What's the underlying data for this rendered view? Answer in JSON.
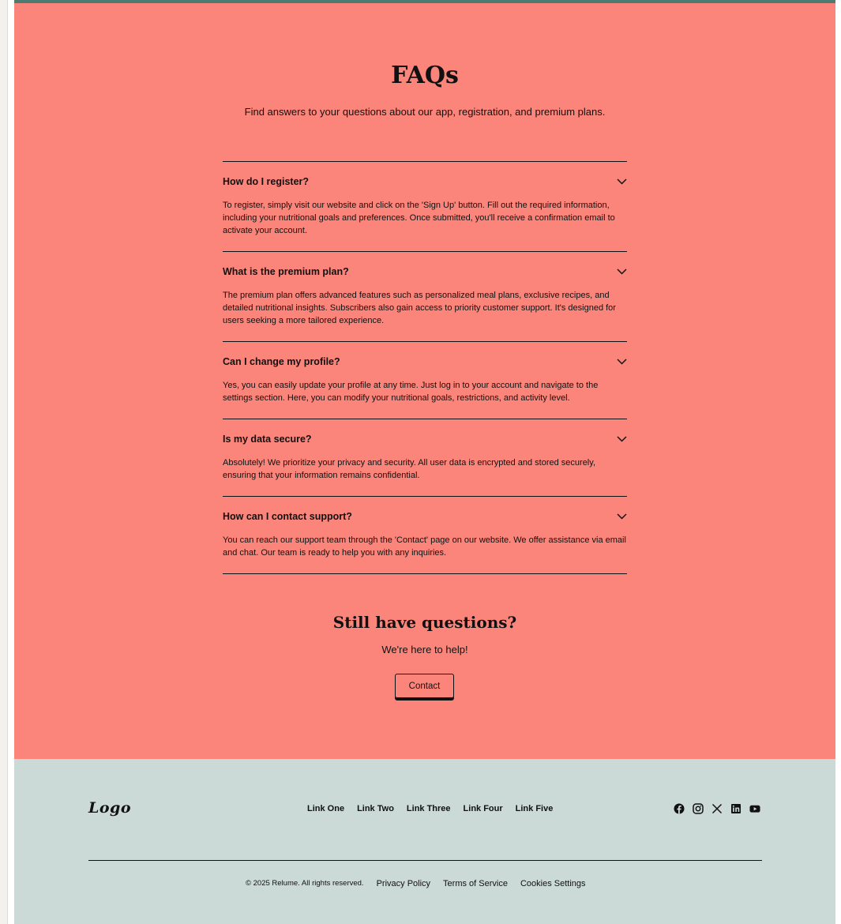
{
  "faq": {
    "title": "FAQs",
    "subtitle": "Find answers to your questions about our app, registration, and premium plans.",
    "items": [
      {
        "question": "How do I register?",
        "answer": "To register, simply visit our website and click on the 'Sign Up' button. Fill out the required information, including your nutritional goals and preferences. Once submitted, you'll receive a confirmation email to activate your account."
      },
      {
        "question": "What is the premium plan?",
        "answer": "The premium plan offers advanced features such as personalized meal plans, exclusive recipes, and detailed nutritional insights. Subscribers also gain access to priority customer support. It's designed for users seeking a more tailored experience."
      },
      {
        "question": "Can I change my profile?",
        "answer": "Yes, you can easily update your profile at any time. Just log in to your account and navigate to the settings section. Here, you can modify your nutritional goals, restrictions, and activity level."
      },
      {
        "question": "Is my data secure?",
        "answer": "Absolutely! We prioritize your privacy and security. All user data is encrypted and stored securely, ensuring that your information remains confidential."
      },
      {
        "question": "How can I contact support?",
        "answer": "You can reach our support team through the 'Contact' page on our website. We offer assistance via email and chat. Our team is ready to help you with any inquiries."
      }
    ]
  },
  "cta": {
    "title": "Still have questions?",
    "subtitle": "We're here to help!",
    "button_label": "Contact"
  },
  "footer": {
    "logo": "Logo",
    "links": [
      "Link One",
      "Link Two",
      "Link Three",
      "Link Four",
      "Link Five"
    ],
    "social_icons": [
      "facebook-icon",
      "instagram-icon",
      "x-icon",
      "linkedin-icon",
      "youtube-icon"
    ],
    "copyright": "© 2025 Relume. All rights reserved.",
    "legal_links": [
      "Privacy Policy",
      "Terms of Service",
      "Cookies Settings"
    ]
  },
  "colors": {
    "accent_bar": "#4f7a72",
    "faq_background": "#fb857a",
    "footer_background": "#cbdad6",
    "text": "#111111"
  }
}
